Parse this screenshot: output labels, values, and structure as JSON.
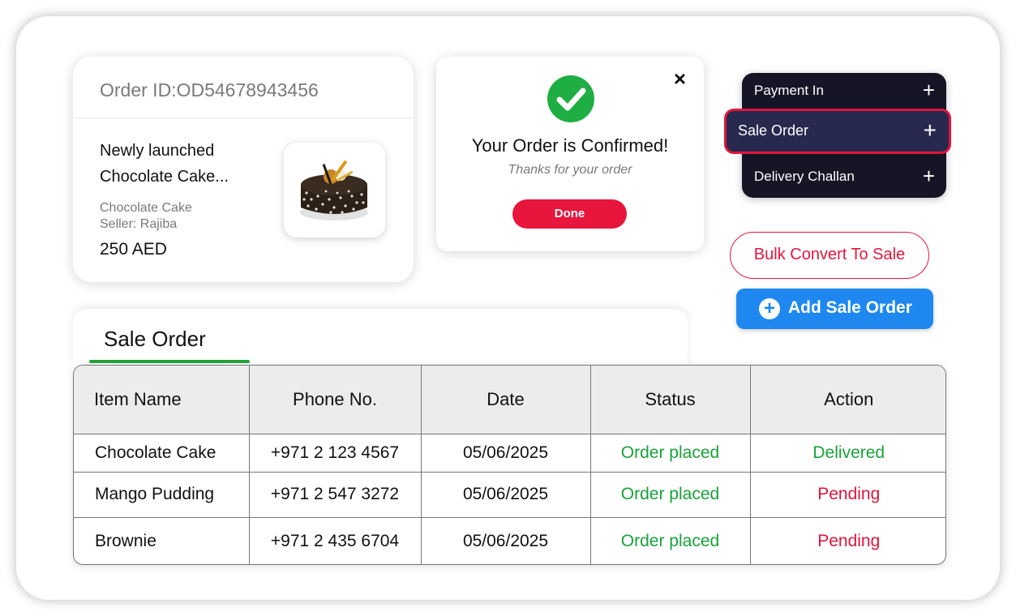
{
  "order_card": {
    "order_id": "Order ID:OD54678943456",
    "product_title": "Newly launched Chocolate Cake...",
    "product_name": "Chocolate Cake",
    "seller": "Seller: Rajiba",
    "price": "250 AED",
    "image_icon": "chocolate-cake-image"
  },
  "confirm_dialog": {
    "title": "Your Order is Confirmed!",
    "subtitle": "Thanks for your order",
    "done_label": "Done",
    "close_icon": "×",
    "check_color": "#1fae44"
  },
  "menu": {
    "items": [
      {
        "label": "Payment In",
        "icon": "+"
      },
      {
        "label": "Sale Order",
        "icon": "+"
      },
      {
        "label": "Delivery Challan",
        "icon": "+"
      }
    ],
    "highlight_color": "#e0153c"
  },
  "actions": {
    "bulk_convert_label": "Bulk Convert To Sale",
    "add_sale_order_label": "Add Sale Order",
    "add_icon": "+"
  },
  "sale_order": {
    "tab_label": "Sale Order",
    "columns": [
      "Item Name",
      "Phone No.",
      "Date",
      "Status",
      "Action"
    ],
    "rows": [
      {
        "item": "Chocolate Cake",
        "phone": "+971 2 123 4567",
        "date": "05/06/2025",
        "status": "Order placed",
        "action": "Delivered",
        "action_color": "green"
      },
      {
        "item": "Mango Pudding",
        "phone": "+971 2 547 3272",
        "date": "05/06/2025",
        "status": "Order placed",
        "action": "Pending",
        "action_color": "red"
      },
      {
        "item": "Brownie",
        "phone": "+971 2 435 6704",
        "date": "05/06/2025",
        "status": "Order placed",
        "action": "Pending",
        "action_color": "red"
      }
    ]
  },
  "colors": {
    "accent_red": "#e8163c",
    "accent_blue": "#1e88f0",
    "status_green": "#17a33a",
    "menu_bg": "#151525"
  }
}
